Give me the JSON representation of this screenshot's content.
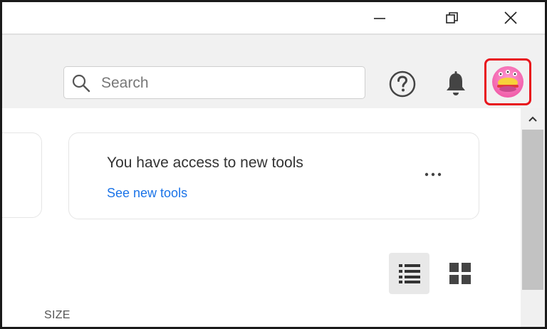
{
  "window": {
    "controls": {
      "minimize_icon": "minimize-icon",
      "maximize_icon": "restore-icon",
      "close_icon": "close-icon"
    }
  },
  "toolbar": {
    "search": {
      "placeholder": "Search",
      "value": "",
      "icon": "search-icon"
    },
    "help_icon": "help-icon",
    "notifications_icon": "bell-icon",
    "avatar_icon": "avatar-icon",
    "highlight_color": "#e8141c"
  },
  "main": {
    "notice_card": {
      "title": "You have access to new tools",
      "link": "See new tools",
      "more_icon": "more-icon"
    },
    "view_toggle": {
      "list_icon": "list-view-icon",
      "grid_icon": "grid-view-icon",
      "selected": "list"
    },
    "column_header": "SIZE"
  },
  "colors": {
    "link": "#1a73e8",
    "toolbar_bg": "#f1f1f1"
  }
}
